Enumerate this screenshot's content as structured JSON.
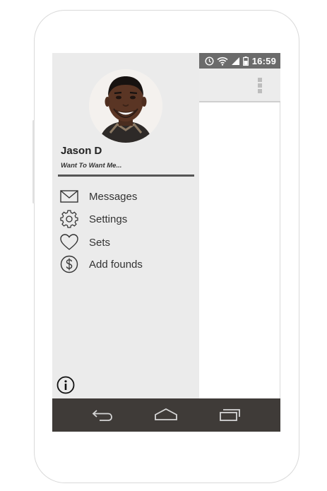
{
  "status_bar": {
    "time": "16:59",
    "icons": [
      "alarm-icon",
      "wifi-icon",
      "cell-signal-icon",
      "battery-icon"
    ]
  },
  "drawer": {
    "user": {
      "name": "Jason D",
      "status": "Want To Want Me..."
    },
    "menu": [
      {
        "icon": "mail-icon",
        "label": "Messages"
      },
      {
        "icon": "gear-icon",
        "label": "Settings"
      },
      {
        "icon": "heart-icon",
        "label": "Sets"
      },
      {
        "icon": "dollar-icon",
        "label": "Add founds"
      }
    ],
    "footer_icon": "info-icon"
  },
  "app_bar": {
    "menu_icon": "overflow-menu-icon"
  },
  "nav_bar": {
    "buttons": [
      "back-icon",
      "home-icon",
      "recents-icon"
    ]
  },
  "colors": {
    "status_bar": "#6b6b6b",
    "drawer_bg": "#ebebeb",
    "app_bar_bg": "#ececec",
    "nav_bar_bg": "#3f3b38",
    "divider": "#555555"
  }
}
